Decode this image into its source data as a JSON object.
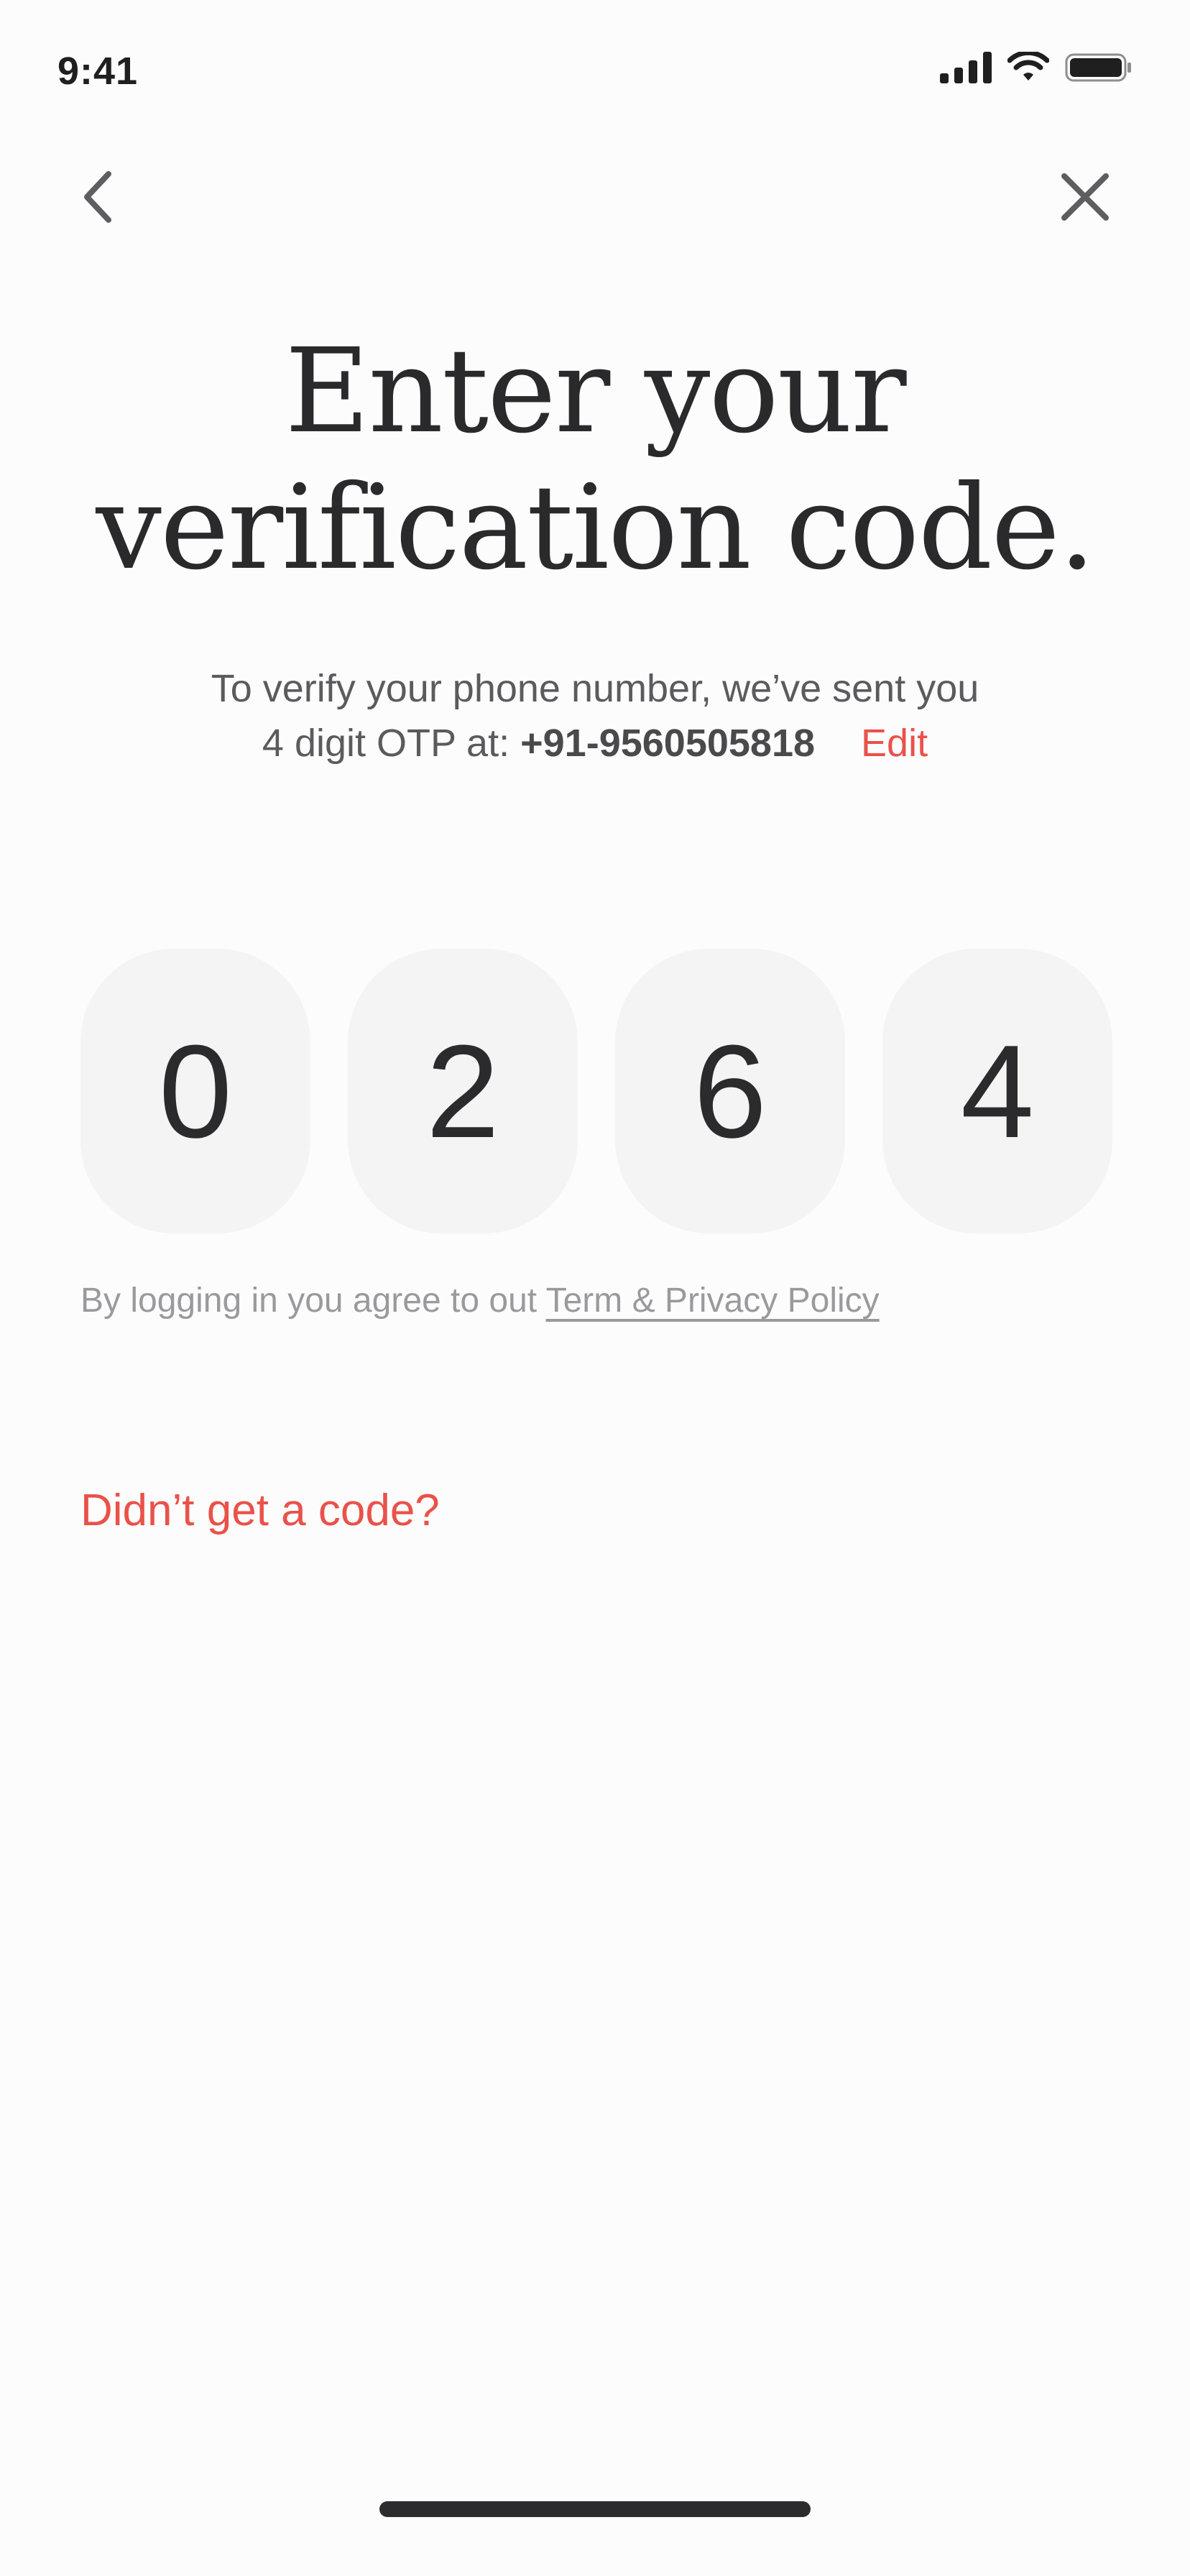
{
  "status_bar": {
    "time": "9:41"
  },
  "nav": {
    "back_icon": "chevron-left-icon",
    "close_icon": "close-icon"
  },
  "title": {
    "line1": "Enter your",
    "line2": "verification code."
  },
  "subtitle": {
    "line1": "To verify your phone number, we’ve sent you",
    "line2_prefix": "4 digit OTP at: ",
    "phone": "+91-9560505818",
    "edit_label": "Edit"
  },
  "otp": {
    "digits": [
      "0",
      "2",
      "6",
      "4"
    ]
  },
  "terms": {
    "prefix": "By logging in you agree to out ",
    "link_label": "Term & Privacy Policy"
  },
  "resend": {
    "label": "Didn’t get a code?"
  },
  "colors": {
    "accent": "#e9524a",
    "text_primary": "#2b2b2e",
    "text_secondary": "#5b5b5e",
    "text_muted": "#9a9a9d",
    "otp_box_bg": "#f4f4f4",
    "background": "#fdfcfc"
  }
}
